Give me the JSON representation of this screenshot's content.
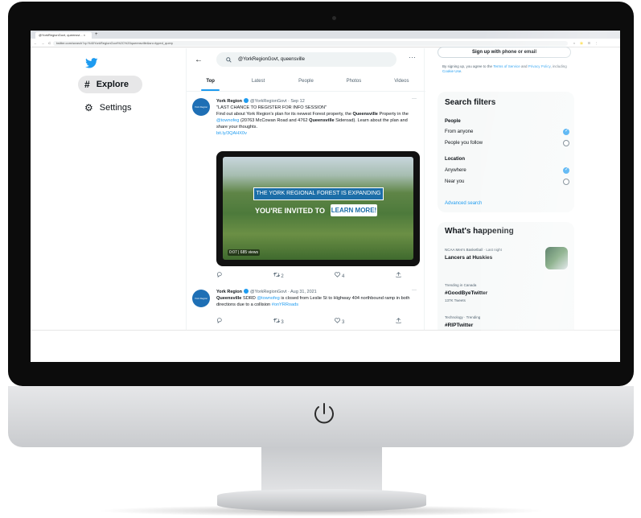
{
  "browser": {
    "tab_title": "@YorkRegionGovt, queensvi...",
    "tab_close": "×",
    "new_tab": "+",
    "url": "twitter.com/search?q=%40YorkRegionGovt%2C%20queensville&src=typed_query",
    "nav_icons": "← → C ⌂",
    "tool_icons": "◐ ⭐ ☰ ⋮"
  },
  "nav": {
    "explore_label": "Explore",
    "settings_label": "Settings",
    "explore_icon": "#",
    "settings_icon": "⚙"
  },
  "search": {
    "back": "←",
    "query": "@YorkRegionGovt, queensville",
    "more": "···",
    "tabs": [
      "Top",
      "Latest",
      "People",
      "Photos",
      "Videos"
    ],
    "active_tab": "Top"
  },
  "tweets": [
    {
      "avatar_text": "York Region",
      "name": "York Region",
      "handle_time": "@YorkRegionGovt · Sep 12",
      "more": "···",
      "text_line1": "\"LAST CHANCE TO REGISTER FOR INFO SESSION\"",
      "text_line2a": "Find out about York Region's plan for its newest Forest property, the ",
      "bold1": "Queensville",
      "text_line2b": " Property in the ",
      "mention1": "@townofeg",
      "text_line2c": " (20763 McCowan Road and 4762 ",
      "bold2": "Queensville",
      "text_line2d": " Sideroad). Learn about the plan and share your thoughts.",
      "link": "bit.ly/3QAHX0v",
      "media": {
        "banner1": "THE YORK REGIONAL FOREST IS EXPANDING",
        "banner2": "YOU'RE INVITED TO",
        "learn": "LEARN MORE!",
        "timestamp": "0:07 | 685 views"
      },
      "actions": {
        "reply": "",
        "retweet_count": "2",
        "like_count": "4",
        "share": ""
      }
    },
    {
      "avatar_text": "York Region",
      "name": "York Region",
      "handle_time": "@YorkRegionGovt · Aug 31, 2021",
      "more": "···",
      "bold1": "Queensville",
      "text_a": " SDRD ",
      "mention1": "@townofeg",
      "text_b": " is closed from Leslie St to Highway 404 northbound ramp in both directions due to a collision ",
      "hashtag": "#onYRRoads",
      "actions": {
        "reply": "",
        "retweet_count": "3",
        "like_count": "3",
        "share": ""
      }
    }
  ],
  "right": {
    "signup_label": "Sign up with phone or email",
    "terms_a": "By signing up, you agree to the ",
    "terms_link1": "Terms of Service",
    "terms_b": " and ",
    "terms_link2": "Privacy Policy",
    "terms_c": ", including ",
    "terms_link3": "Cookie Use",
    "terms_d": ".",
    "filters": {
      "heading": "Search filters",
      "people_heading": "People",
      "people_options": [
        "From anyone",
        "People you follow"
      ],
      "people_selected": 0,
      "location_heading": "Location",
      "location_options": [
        "Anywhere",
        "Near you"
      ],
      "location_selected": 0,
      "advanced": "Advanced search"
    },
    "happening": {
      "heading": "What's happening",
      "items": [
        {
          "meta": "NCAA Men's Basketball · Last night",
          "title": "Lancers at Huskies",
          "count": ""
        },
        {
          "meta": "Trending in Canada",
          "title": "#GoodByeTwitter",
          "count": "137K Tweets"
        },
        {
          "meta": "Technology · Trending",
          "title": "#RIPTwitter",
          "count": ""
        }
      ]
    }
  },
  "colors": {
    "accent": "#1d9bf0",
    "text": "#0f1419",
    "muted": "#536471",
    "bezel": "#0c0c0c"
  }
}
